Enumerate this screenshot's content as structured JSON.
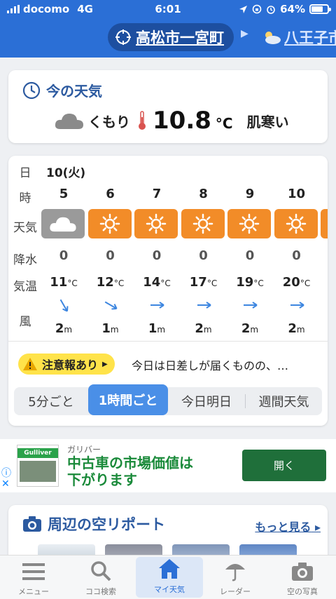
{
  "status": {
    "carrier": "docomo",
    "network": "4G",
    "time": "6:01",
    "battery": "64%"
  },
  "header": {
    "current_location": "高松市一宮町",
    "next_location": "八王子市"
  },
  "now": {
    "title": "今の天気",
    "condition": "くもり",
    "temperature": "10.8",
    "unit": "°C",
    "feeling": "肌寒い"
  },
  "forecast": {
    "row_labels": {
      "day": "日",
      "hour": "時",
      "weather": "天気",
      "precip": "降水",
      "temp": "気温",
      "wind": "風"
    },
    "day": "10(火)",
    "hours": [
      {
        "hour": "5",
        "icon": "cloud-icon",
        "precip": "0",
        "temp": "11",
        "wind_dir": "NNE",
        "wind_speed": "2"
      },
      {
        "hour": "6",
        "icon": "sun-icon",
        "precip": "0",
        "temp": "12",
        "wind_dir": "NE",
        "wind_speed": "1"
      },
      {
        "hour": "7",
        "icon": "sun-icon",
        "precip": "0",
        "temp": "14",
        "wind_dir": "E",
        "wind_speed": "1"
      },
      {
        "hour": "8",
        "icon": "sun-icon",
        "precip": "0",
        "temp": "17",
        "wind_dir": "E",
        "wind_speed": "2"
      },
      {
        "hour": "9",
        "icon": "sun-icon",
        "precip": "0",
        "temp": "19",
        "wind_dir": "E",
        "wind_speed": "2"
      },
      {
        "hour": "10",
        "icon": "sun-icon",
        "precip": "0",
        "temp": "20",
        "wind_dir": "E",
        "wind_speed": "2"
      }
    ],
    "temp_unit": "°C",
    "wind_unit": "m",
    "colors": {
      "sun_bg": "#f28c28",
      "cloud_bg": "#9a9a9a"
    }
  },
  "alert": {
    "badge": "注意報あり",
    "text": "今日は日差しが届くものの、…"
  },
  "segments": [
    "5分ごと",
    "1時間ごと",
    "今日明日",
    "週間天気"
  ],
  "active_segment": "1時間ごと",
  "ad": {
    "logo_text": "Gulliver",
    "brand": "ガリバー",
    "copy_line1": "中古車の市場価値は",
    "copy_line2": "下がります",
    "button": "開く"
  },
  "sky": {
    "title": "周辺の空リポート",
    "more": "もっと見る"
  },
  "tabs": [
    {
      "label": "メニュー",
      "icon": "menu-icon"
    },
    {
      "label": "ココ検索",
      "icon": "search-icon"
    },
    {
      "label": "マイ天気",
      "icon": "home-icon"
    },
    {
      "label": "レーダー",
      "icon": "umbrella-icon"
    },
    {
      "label": "空の写真",
      "icon": "camera-icon"
    }
  ],
  "active_tab": "マイ天気",
  "accent_color": "#2b6fd6"
}
